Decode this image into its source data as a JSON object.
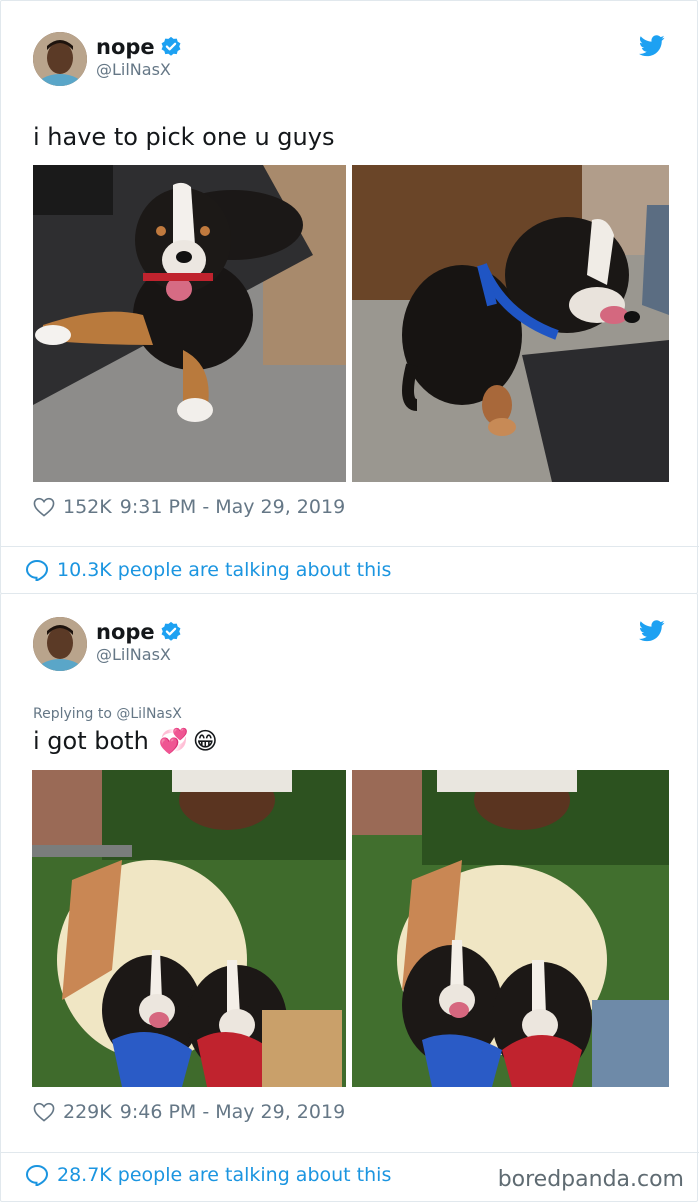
{
  "tweets": [
    {
      "author": {
        "display_name": "nope",
        "handle": "@LilNasX",
        "verified": true
      },
      "replying_to": "",
      "text": "i have to pick one u guys",
      "emoji": [],
      "likes": "152K",
      "timestamp": "9:31 PM - May 29, 2019",
      "talking": "10.3K people are talking about this",
      "photos": [
        "puppy lying on office floor mat",
        "puppy in blue harness sitting"
      ]
    },
    {
      "author": {
        "display_name": "nope",
        "handle": "@LilNasX",
        "verified": true
      },
      "replying_to": "Replying to @LilNasX",
      "text": "i got both",
      "emoji": [
        "💞",
        "😁"
      ],
      "likes": "229K",
      "timestamp": "9:46 PM - May 29, 2019",
      "talking": "28.7K people are talking about this",
      "photos": [
        "man in cowboy hat hugging two puppies",
        "man in cowboy hat with two puppies outdoors"
      ]
    }
  ],
  "icons": {
    "verified": "verified-badge-icon",
    "bird": "twitter-bird-icon",
    "heart": "heart-icon",
    "bubble": "speech-bubble-icon"
  },
  "colors": {
    "twitter_blue": "#1da1f2",
    "link_blue": "#1b95e0",
    "gray": "#657786"
  },
  "watermark": "boredpanda.com"
}
